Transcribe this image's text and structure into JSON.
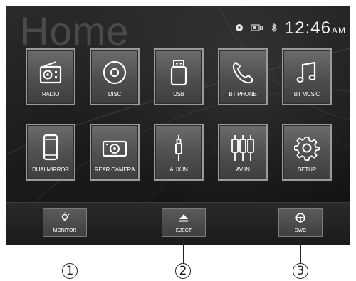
{
  "header": {
    "title": "Home",
    "time": "12:46",
    "ampm": "AM"
  },
  "status_icons": [
    "disc-status-icon",
    "card-status-icon",
    "bluetooth-icon"
  ],
  "apps": [
    {
      "label": "RADIO",
      "icon": "radio-icon"
    },
    {
      "label": "DISC",
      "icon": "disc-icon"
    },
    {
      "label": "USB",
      "icon": "usb-icon"
    },
    {
      "label": "BT PHONE",
      "icon": "phone-icon"
    },
    {
      "label": "BT MUSIC",
      "icon": "music-note-icon"
    },
    {
      "label": "DUALMIRROR",
      "icon": "smartphone-icon"
    },
    {
      "label": "REAR CAMERA",
      "icon": "camera-icon"
    },
    {
      "label": "AUX IN",
      "icon": "aux-jack-icon"
    },
    {
      "label": "AV IN",
      "icon": "rca-plugs-icon"
    },
    {
      "label": "SETUP",
      "icon": "gear-icon"
    }
  ],
  "bottom_bar": {
    "monitor": "MONITOR",
    "eject": "EJECT",
    "swc": "SWC"
  },
  "callouts": [
    "1",
    "2",
    "3"
  ],
  "colors": {
    "tile_border": "#9a9a9a",
    "title_gray": "#4a4a4a",
    "text": "#ffffff"
  }
}
